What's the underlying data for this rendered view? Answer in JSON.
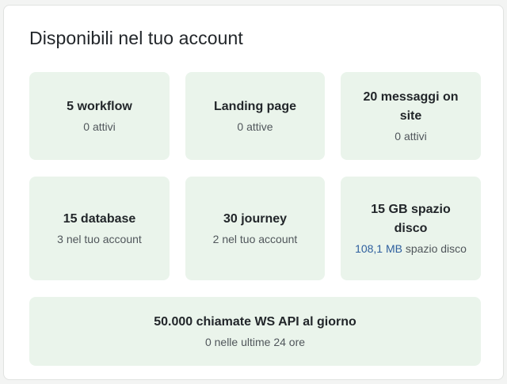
{
  "panel": {
    "title": "Disponibili nel tuo account"
  },
  "tiles": [
    {
      "title": "5 workflow",
      "subtitle": "0 attivi"
    },
    {
      "title": "Landing page",
      "subtitle": "0 attive"
    },
    {
      "title": "20 messaggi on site",
      "subtitle": "0 attivi"
    },
    {
      "title": "15 database",
      "subtitle": "3 nel tuo account"
    },
    {
      "title": "30 journey",
      "subtitle": "2 nel tuo account"
    },
    {
      "title": "15 GB spazio disco",
      "subtitle_link": "108,1 MB",
      "subtitle_rest": " spazio disco"
    },
    {
      "title": "50.000 chiamate WS API al giorno",
      "subtitle": "0 nelle ultime 24 ore"
    }
  ],
  "colors": {
    "tile_background": "#eaf4eb",
    "link": "#2e5f9e"
  }
}
